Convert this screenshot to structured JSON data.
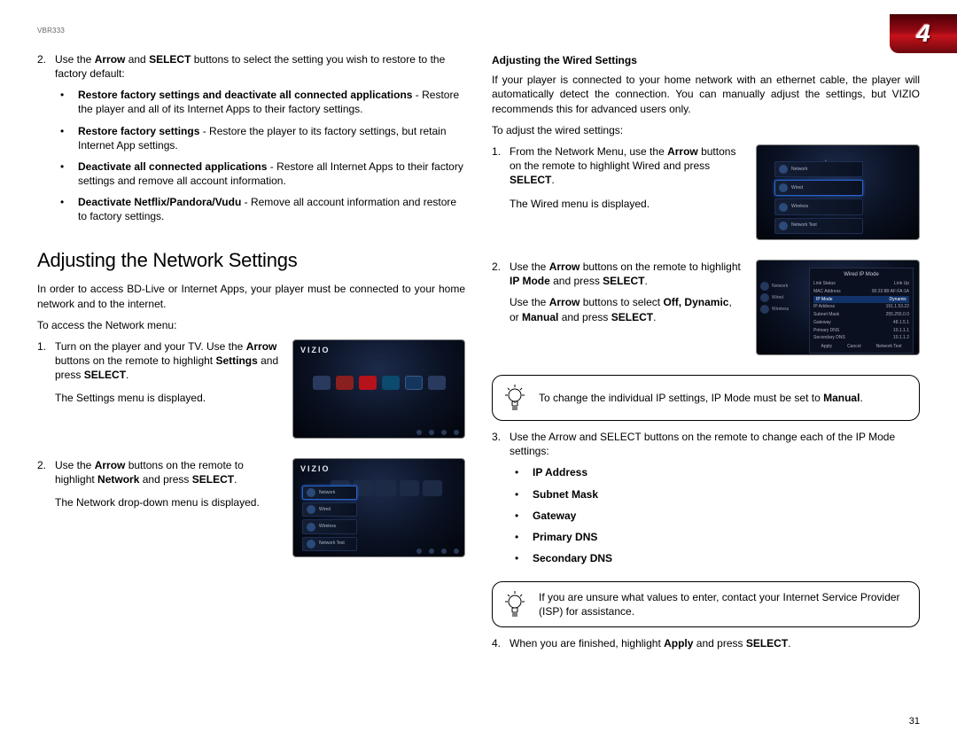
{
  "model": "VBR333",
  "chapter_number": "4",
  "page_number": "31",
  "left": {
    "step2_num": "2.",
    "step2_intro": "Use the ",
    "step2_arrow": "Arrow",
    "step2_and": " and ",
    "step2_select": "SELECT",
    "step2_rest": " buttons to select the setting you wish to restore to the factory default:",
    "bullets": [
      {
        "bold": "Restore factory settings and deactivate all connected applications",
        "rest": " - Restore the player and all of its Internet Apps to their factory settings."
      },
      {
        "bold": "Restore factory settings",
        "rest": " - Restore the player to its factory settings, but retain Internet App settings."
      },
      {
        "bold": "Deactivate all connected applications",
        "rest": " - Restore all Internet Apps to their factory settings and remove all account information."
      },
      {
        "bold": "Deactivate Netflix/Pandora/Vudu",
        "rest": " - Remove all account information and restore to factory settings."
      }
    ],
    "heading": "Adjusting the Network Settings",
    "intro": "In order to access BD-Live or Internet Apps, your player must be connected to your home network and to the internet.",
    "access": "To access the Network menu:",
    "s1_num": "1.",
    "s1_a": "Turn on the player and your TV. Use the ",
    "s1_arrow": "Arrow",
    "s1_b": " buttons on the remote to highlight ",
    "s1_settings": "Settings",
    "s1_c": " and press ",
    "s1_select": "SELECT",
    "s1_d": ".",
    "s1_note": "The Settings menu is displayed.",
    "s2_num": "2.",
    "s2_a": "Use the ",
    "s2_arrow": "Arrow",
    "s2_b": " buttons on the remote to highlight ",
    "s2_net": "Network",
    "s2_c": " and press ",
    "s2_select": "SELECT",
    "s2_d": ".",
    "s2_note": "The Network drop-down menu is displayed."
  },
  "right": {
    "heading": "Adjusting the Wired Settings",
    "intro": "If your player is connected to your home network with an ethernet cable, the player will automatically detect the connection. You can manually adjust the settings, but VIZIO recommends this for advanced users only.",
    "adjust": "To adjust the wired settings:",
    "s1_num": "1.",
    "s1_a": "From the Network Menu, use the ",
    "s1_arrow": "Arrow",
    "s1_b": " buttons on the remote to highlight Wired and press ",
    "s1_select": "SELECT",
    "s1_d": ".",
    "s1_note": "The Wired menu is displayed.",
    "s2_num": "2.",
    "s2_a": "Use the ",
    "s2_arrow": "Arrow",
    "s2_b": " buttons on the remote to highlight ",
    "s2_ip": "IP Mode",
    "s2_c": " and press ",
    "s2_select": "SELECT",
    "s2_d": ".",
    "s2_use": "Use the ",
    "s2_arrow2": "Arrow",
    "s2_use2": " buttons to select ",
    "s2_off": "Off, Dynamic",
    "s2_or": ", or ",
    "s2_manual": "Manual",
    "s2_and": " and press ",
    "s2_select2": "SELECT",
    "s2_end": ".",
    "tip1_a": "To change the individual IP settings, IP Mode must be set to ",
    "tip1_b": "Manual",
    "tip1_c": ".",
    "s3_num": "3.",
    "s3_txt": "Use the Arrow and SELECT buttons on the remote to change each of the IP Mode settings:",
    "s3_items": [
      "IP Address",
      "Subnet Mask",
      "Gateway",
      "Primary DNS",
      "Secondary DNS"
    ],
    "tip2": "If you are unsure what values to enter, contact your Internet Service Provider (ISP) for assistance.",
    "s4_num": "4.",
    "s4_a": "When you are finished, highlight ",
    "s4_apply": "Apply",
    "s4_b": " and press ",
    "s4_select": "SELECT",
    "s4_c": "."
  },
  "tv": {
    "brand": "VIZIO",
    "panel_items": [
      "Network",
      "Wired",
      "Wireless",
      "Network Test"
    ],
    "left_items": [
      "Network",
      "Wired",
      "Wireless"
    ],
    "wired_title": "Wired IP Mode",
    "wired_rows": [
      [
        "Link Status",
        "Link Up"
      ],
      [
        "MAC Address",
        "00:22:88:AF:FA:1A"
      ],
      [
        "IP Mode",
        "Dynamic"
      ],
      [
        "IP Address",
        "191.1.53.22"
      ],
      [
        "Subnet Mask",
        "255.255.0.0"
      ],
      [
        "Gateway",
        "48.1.5.1"
      ],
      [
        "Primary DNS",
        "10.1.1.1"
      ],
      [
        "Secondary DNS",
        "10.1.1.2"
      ]
    ],
    "wired_btns": [
      "Apply",
      "Cancel",
      "Network Test"
    ]
  }
}
